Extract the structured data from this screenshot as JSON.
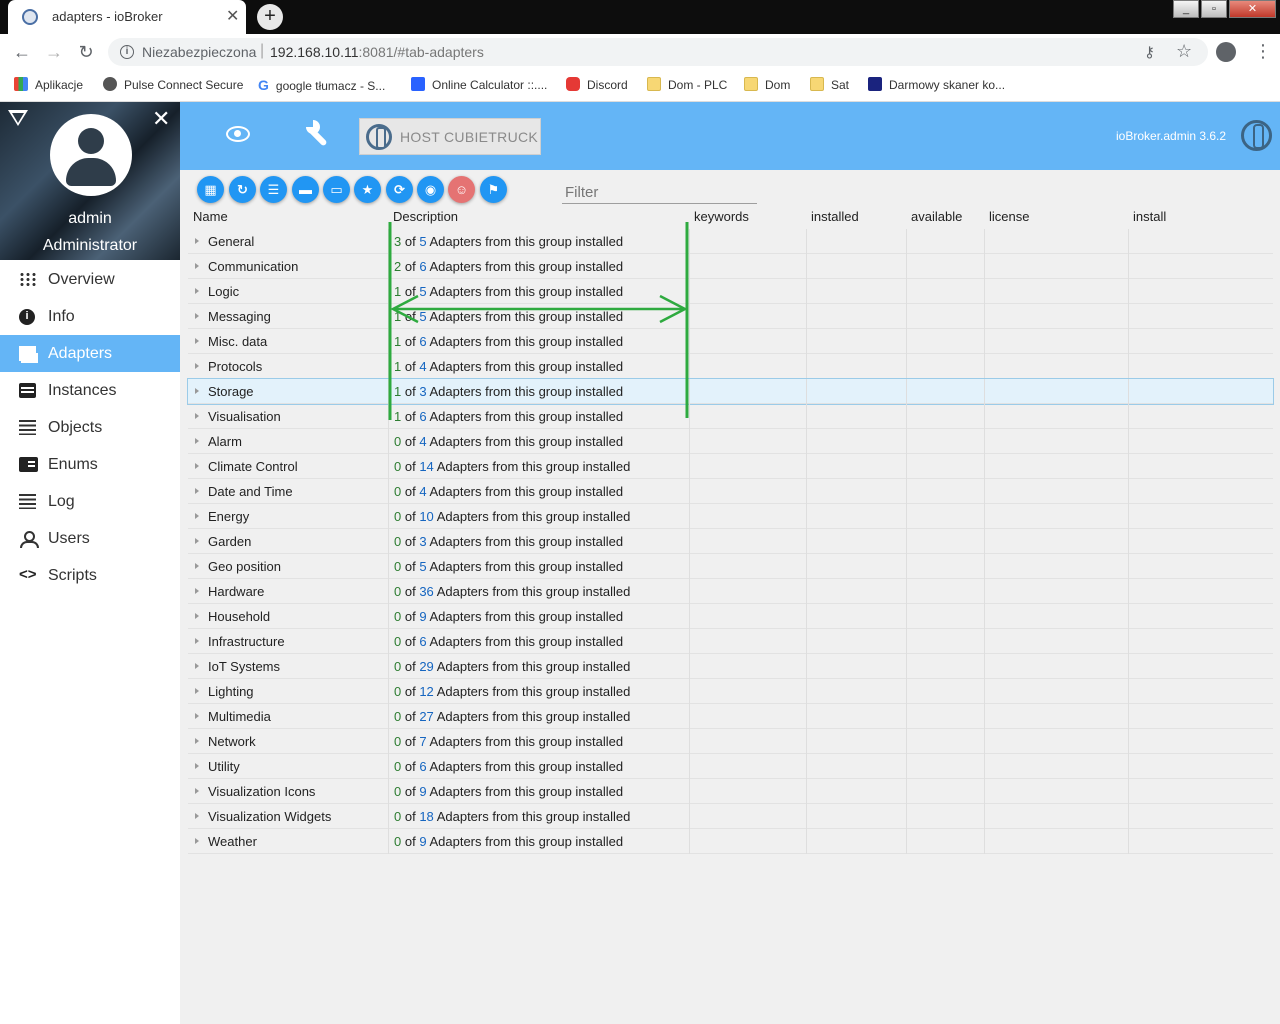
{
  "browser": {
    "tab_title": "adapters - ioBroker",
    "tab_close": "✕",
    "new_tab": "+",
    "security_label": "Niezabezpieczona",
    "url_host": "192.168.10.11",
    "url_rest": ":8081/#tab-adapters",
    "bookmarks": [
      "Aplikacje",
      "Pulse Connect Secure",
      "google tłumacz - S...",
      "Online Calculator ::....",
      "Discord",
      "Dom - PLC",
      "Dom",
      "Sat",
      "Darmowy skaner ko..."
    ]
  },
  "sidebar": {
    "user": "admin",
    "role": "Administrator",
    "close": "✕",
    "items": [
      {
        "label": "Overview",
        "icon": "grid-icon"
      },
      {
        "label": "Info",
        "icon": "info-icon"
      },
      {
        "label": "Adapters",
        "icon": "store-icon",
        "active": true
      },
      {
        "label": "Instances",
        "icon": "instances-icon"
      },
      {
        "label": "Objects",
        "icon": "list-icon"
      },
      {
        "label": "Enums",
        "icon": "enums-icon"
      },
      {
        "label": "Log",
        "icon": "log-icon"
      },
      {
        "label": "Users",
        "icon": "user-icon"
      },
      {
        "label": "Scripts",
        "icon": "code-icon"
      }
    ]
  },
  "appbar": {
    "host_label": "HOST CUBIETRUCK",
    "version": "ioBroker.admin 3.6.2"
  },
  "toolbar": {
    "filter_placeholder": "Filter",
    "buttons": [
      "tiles-view-icon",
      "refresh-icon",
      "list-view-icon",
      "folder-icon",
      "folder-open-icon",
      "star-icon",
      "update-icon",
      "github-icon",
      "user-contact-icon",
      "flag-icon"
    ]
  },
  "table": {
    "columns": [
      "Name",
      "Description",
      "keywords",
      "installed",
      "available",
      "license",
      "install"
    ],
    "desc_suffix": "Adapters from this group installed",
    "of_word": "of",
    "rows": [
      {
        "name": "General",
        "installed": 3,
        "total": 5
      },
      {
        "name": "Communication",
        "installed": 2,
        "total": 6
      },
      {
        "name": "Logic",
        "installed": 1,
        "total": 5
      },
      {
        "name": "Messaging",
        "installed": 1,
        "total": 5
      },
      {
        "name": "Misc. data",
        "installed": 1,
        "total": 6
      },
      {
        "name": "Protocols",
        "installed": 1,
        "total": 4
      },
      {
        "name": "Storage",
        "installed": 1,
        "total": 3,
        "selected": true
      },
      {
        "name": "Visualisation",
        "installed": 1,
        "total": 6
      },
      {
        "name": "Alarm",
        "installed": 0,
        "total": 4
      },
      {
        "name": "Climate Control",
        "installed": 0,
        "total": 14
      },
      {
        "name": "Date and Time",
        "installed": 0,
        "total": 4
      },
      {
        "name": "Energy",
        "installed": 0,
        "total": 10
      },
      {
        "name": "Garden",
        "installed": 0,
        "total": 3
      },
      {
        "name": "Geo position",
        "installed": 0,
        "total": 5
      },
      {
        "name": "Hardware",
        "installed": 0,
        "total": 36
      },
      {
        "name": "Household",
        "installed": 0,
        "total": 9
      },
      {
        "name": "Infrastructure",
        "installed": 0,
        "total": 6
      },
      {
        "name": "IoT Systems",
        "installed": 0,
        "total": 29
      },
      {
        "name": "Lighting",
        "installed": 0,
        "total": 12
      },
      {
        "name": "Multimedia",
        "installed": 0,
        "total": 27
      },
      {
        "name": "Network",
        "installed": 0,
        "total": 7
      },
      {
        "name": "Utility",
        "installed": 0,
        "total": 6
      },
      {
        "name": "Visualization Icons",
        "installed": 0,
        "total": 9
      },
      {
        "name": "Visualization Widgets",
        "installed": 0,
        "total": 18
      },
      {
        "name": "Weather",
        "installed": 0,
        "total": 9
      }
    ]
  },
  "annotation": {
    "color": "#2eaa3f"
  }
}
